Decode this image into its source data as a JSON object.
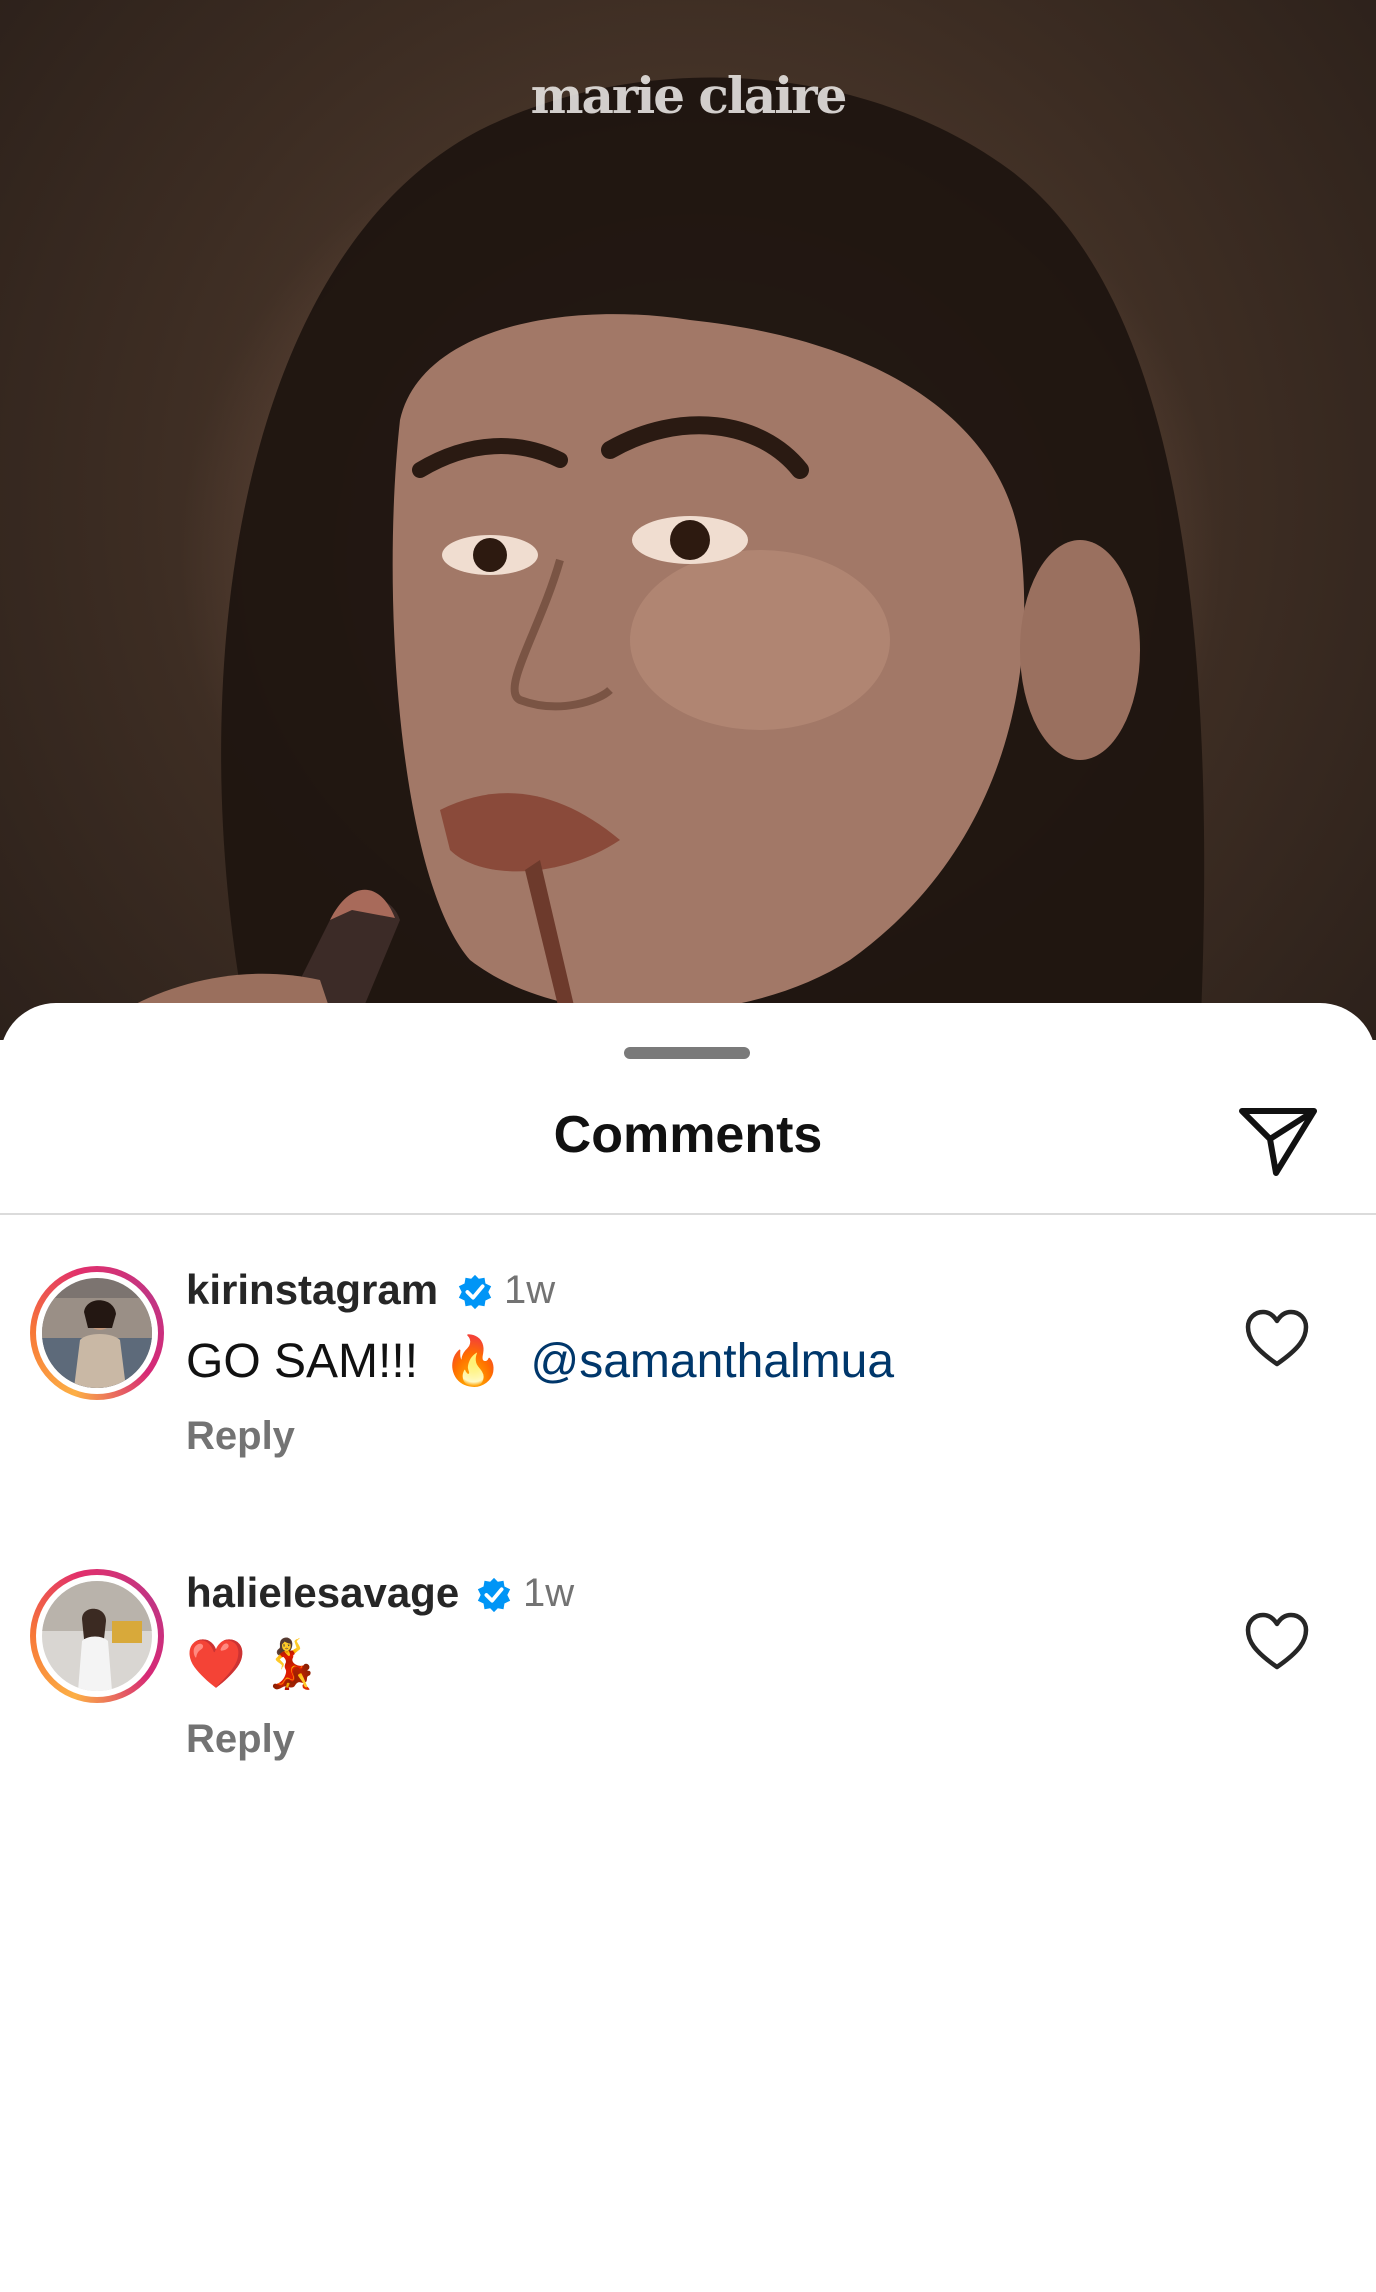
{
  "post": {
    "brand_logo": "marie claire"
  },
  "comments_sheet": {
    "title": "Comments",
    "share_icon": "paper-plane-icon",
    "comments": [
      {
        "username": "kirinstagram",
        "verified": true,
        "time": "1w",
        "text": "GO SAM!!!",
        "emoji": "🔥",
        "mention": "@samanthalmua",
        "reply_label": "Reply",
        "like_icon": "heart-outline-icon"
      },
      {
        "username": "halielesavage",
        "verified": true,
        "time": "1w",
        "text": "",
        "emoji": "❤️ 💃",
        "mention": "",
        "reply_label": "Reply",
        "like_icon": "heart-outline-icon"
      }
    ]
  },
  "colors": {
    "mention": "#00376b",
    "verified": "#0095f6",
    "secondary_text": "#737373"
  }
}
